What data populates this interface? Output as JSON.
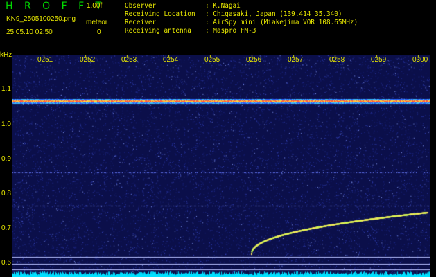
{
  "header": {
    "brand": "H R O F F T",
    "version": "1.00f",
    "filename": "KN9_2505100250.png",
    "timestamp": "25.05.10 02:50",
    "mode_label": "meteor",
    "mode_value": "0"
  },
  "info": [
    {
      "key": "Observer",
      "value": ": K.Nagai"
    },
    {
      "key": "Receiving Location",
      "value": ": Chigasaki, Japan (139.414 35.340)"
    },
    {
      "key": "Receiver",
      "value": ": AirSpy mini (Miakejima VOR 108.65MHz)"
    },
    {
      "key": "Receiving antenna",
      "value": ": Maspro FM-3"
    }
  ],
  "y_axis": {
    "unit": "kHz",
    "ticks": [
      "1.1",
      "1.0",
      "0.9",
      "0.8",
      "0.7",
      "0.6"
    ]
  },
  "x_axis": {
    "ticks": [
      "0251",
      "0252",
      "0253",
      "0254",
      "0255",
      "0256",
      "0257",
      "0258",
      "0259",
      "0300"
    ]
  },
  "colors": {
    "text": "#e8e800",
    "brand": "#00d800",
    "background": "#0b0f4a",
    "carrier": "#ff5a3c",
    "echo": "#c8ff50",
    "noise_floor": "#00e0ff"
  }
}
